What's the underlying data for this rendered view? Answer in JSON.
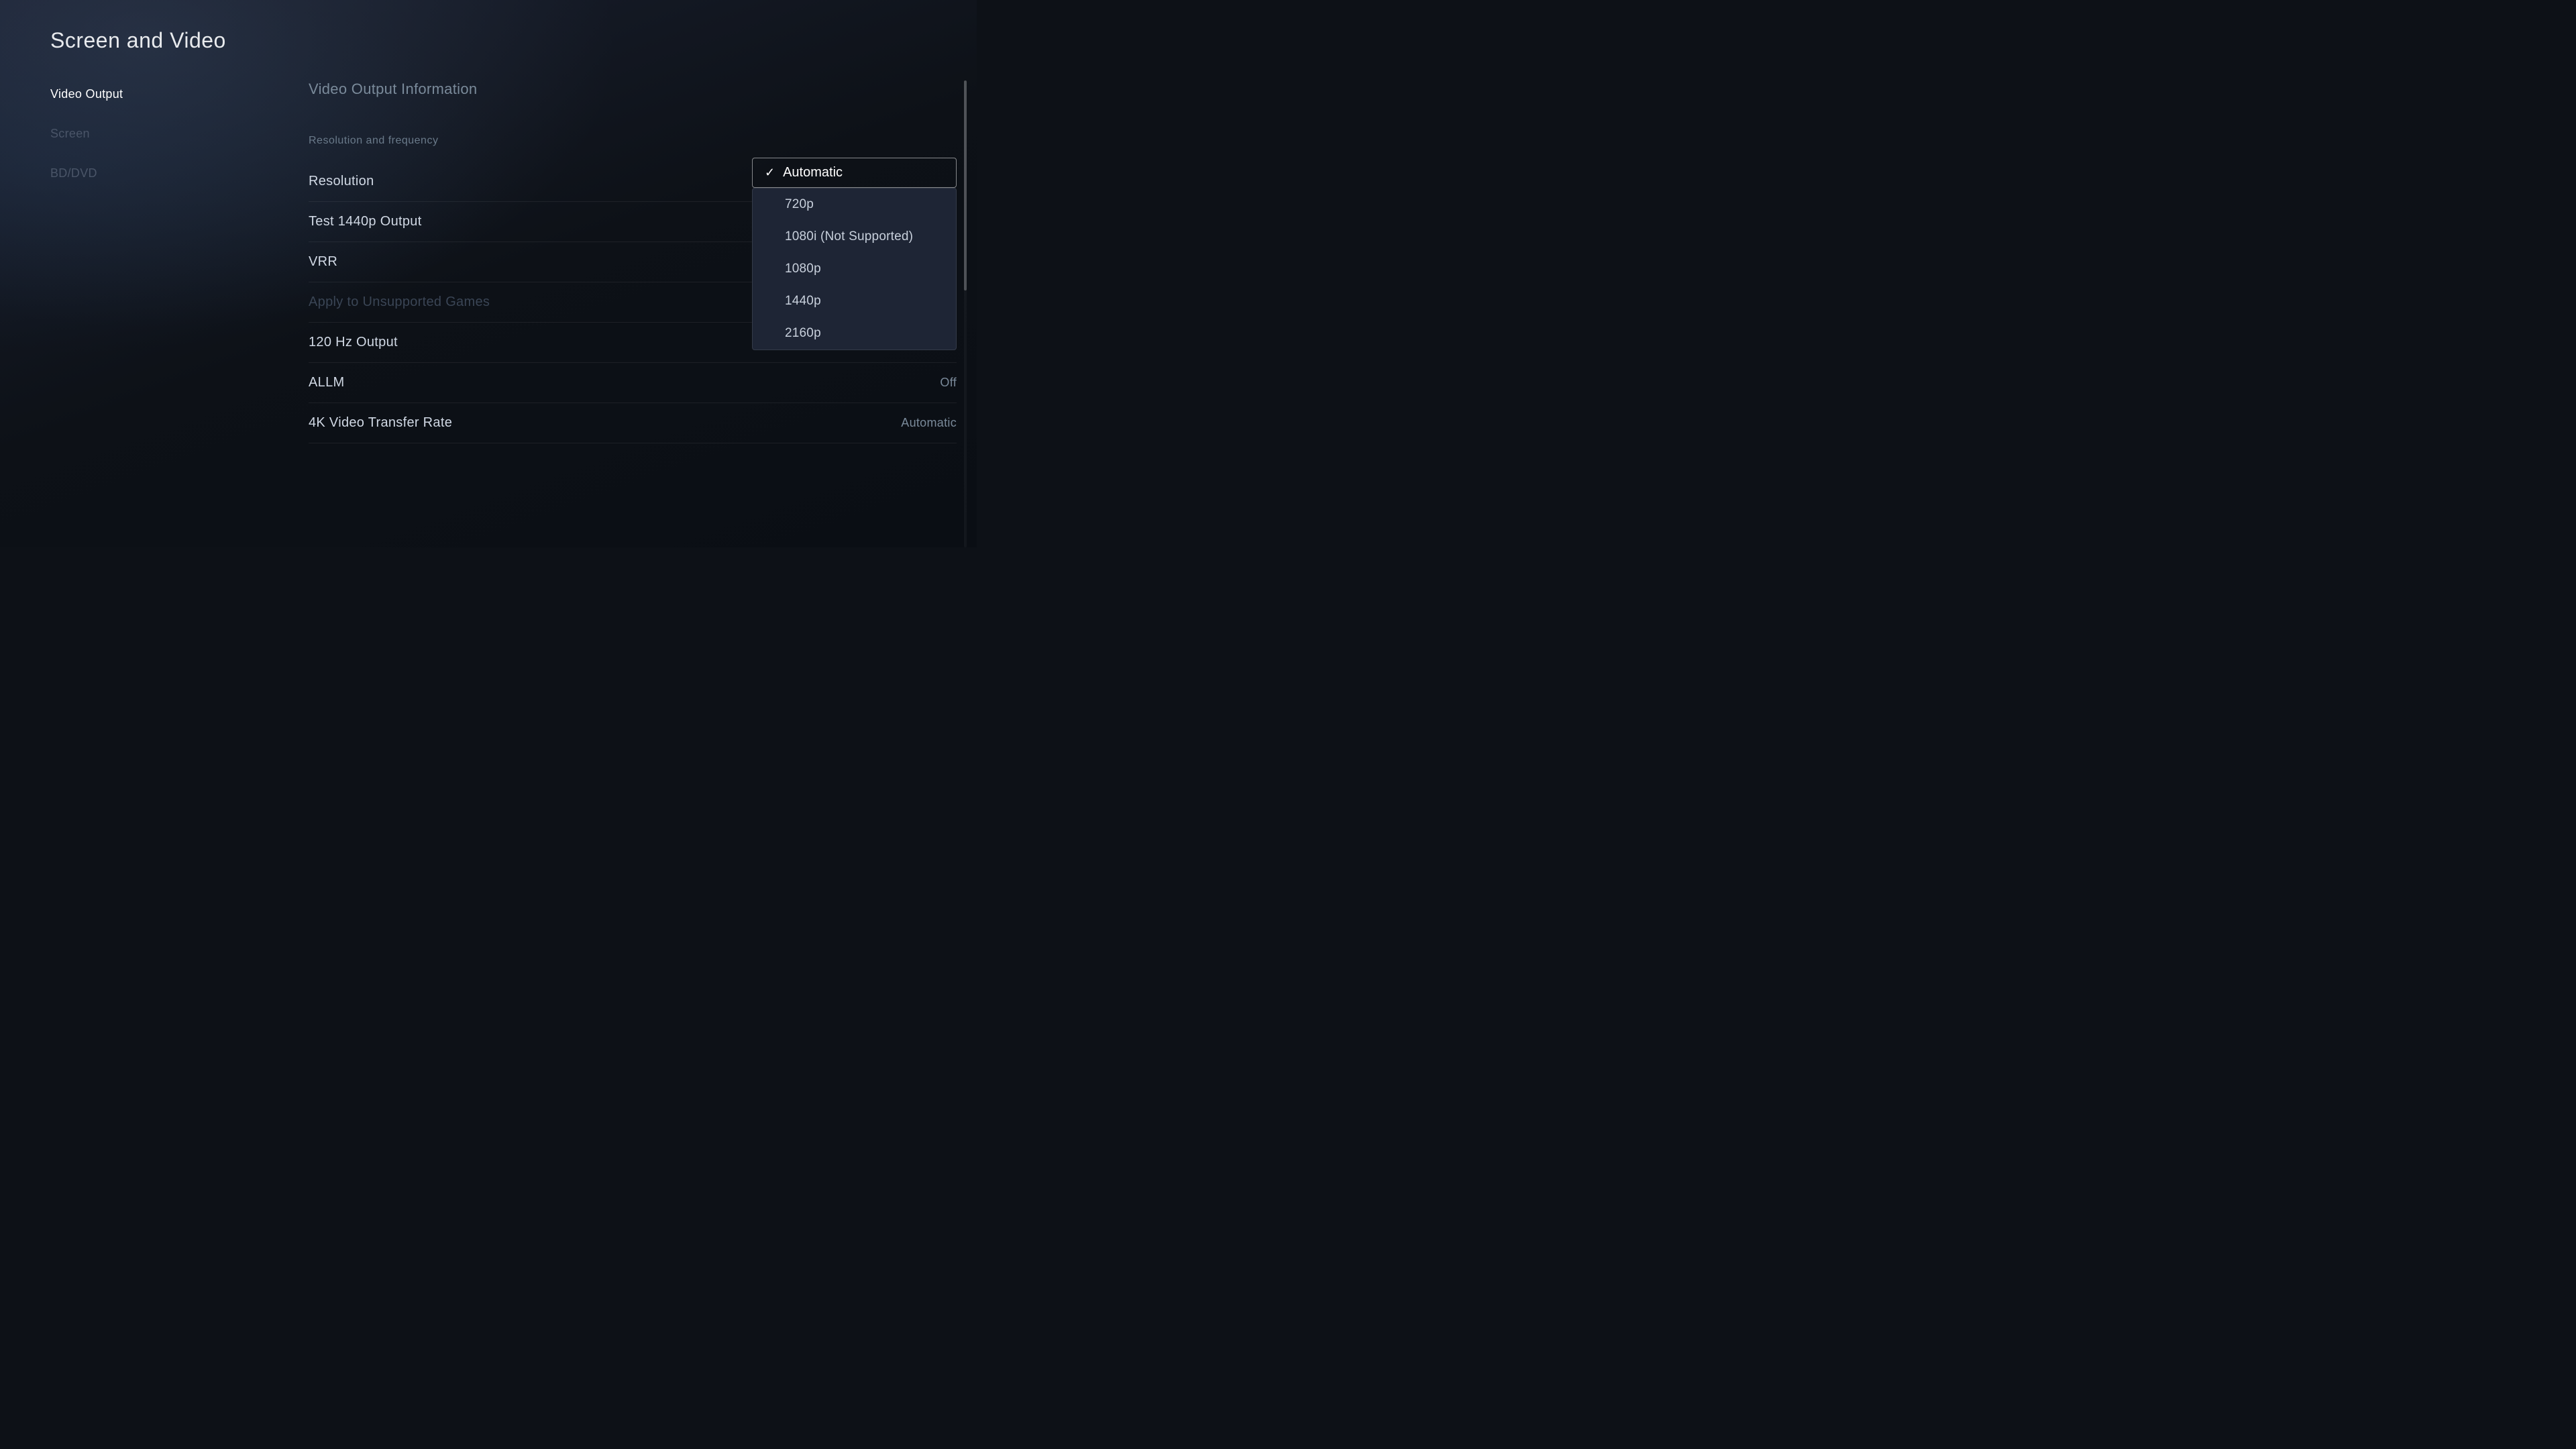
{
  "page": {
    "title": "Screen and Video"
  },
  "sidebar": {
    "items": [
      {
        "id": "video-output",
        "label": "Video Output",
        "state": "active"
      },
      {
        "id": "screen",
        "label": "Screen",
        "state": "inactive"
      },
      {
        "id": "bddvd",
        "label": "BD/DVD",
        "state": "inactive"
      }
    ]
  },
  "main": {
    "top_link": "Video Output Information",
    "section_header": "Resolution and frequency",
    "settings": [
      {
        "id": "resolution",
        "label": "Resolution",
        "value": "",
        "disabled": false,
        "has_dropdown": true
      },
      {
        "id": "test-1440p",
        "label": "Test 1440p Output",
        "value": "",
        "disabled": false
      },
      {
        "id": "vrr",
        "label": "VRR",
        "value": "",
        "disabled": false
      },
      {
        "id": "apply-unsupported",
        "label": "Apply to Unsupported Games",
        "value": "",
        "disabled": true
      },
      {
        "id": "120hz",
        "label": "120 Hz Output",
        "value": "",
        "disabled": false
      },
      {
        "id": "allm",
        "label": "ALLM",
        "value": "Off",
        "disabled": false
      },
      {
        "id": "4k-transfer",
        "label": "4K Video Transfer Rate",
        "value": "Automatic",
        "disabled": false
      }
    ]
  },
  "dropdown": {
    "options": [
      {
        "id": "automatic",
        "label": "Automatic",
        "selected": true
      },
      {
        "id": "720p",
        "label": "720p",
        "selected": false
      },
      {
        "id": "1080i",
        "label": "1080i (Not Supported)",
        "selected": false
      },
      {
        "id": "1080p",
        "label": "1080p",
        "selected": false
      },
      {
        "id": "1440p",
        "label": "1440p",
        "selected": false
      },
      {
        "id": "2160p",
        "label": "2160p",
        "selected": false
      }
    ]
  },
  "colors": {
    "background": "#0d1117",
    "sidebar_active": "#ffffff",
    "sidebar_inactive": "#4a5568",
    "text_primary": "#d0d8e4",
    "text_secondary": "#7a8a9a",
    "text_disabled": "#3a4555",
    "dropdown_bg": "#1e2535",
    "border": "rgba(255,255,255,0.5)"
  }
}
